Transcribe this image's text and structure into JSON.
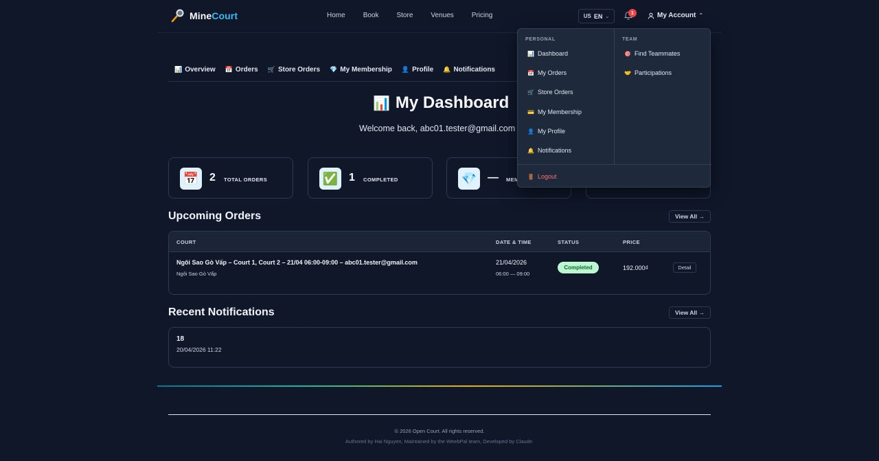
{
  "brand": {
    "name_part1": "Mine",
    "name_part2": "Court"
  },
  "nav": {
    "links": [
      "Home",
      "Book",
      "Store",
      "Venues",
      "Pricing"
    ],
    "lang_country": "US",
    "lang_code": "EN",
    "notification_count": "1",
    "account_label": "My Account"
  },
  "tabs": [
    {
      "icon": "📊",
      "label": "Overview"
    },
    {
      "icon": "📅",
      "label": "Orders"
    },
    {
      "icon": "🛒",
      "label": "Store Orders"
    },
    {
      "icon": "💎",
      "label": "My Membership"
    },
    {
      "icon": "👤",
      "label": "Profile"
    },
    {
      "icon": "🔔",
      "label": "Notifications"
    }
  ],
  "dashboard": {
    "title_icon": "📊",
    "title": "My Dashboard",
    "welcome": "Welcome back, abc01.tester@gmail.com"
  },
  "stats": [
    {
      "icon": "📅",
      "value": "2",
      "label": "TOTAL ORDERS"
    },
    {
      "icon": "✅",
      "value": "1",
      "label": "COMPLETED"
    },
    {
      "icon": "💎",
      "value": "—",
      "label": "MEM"
    }
  ],
  "upcoming": {
    "title": "Upcoming Orders",
    "view_all": "View All →",
    "columns": [
      "COURT",
      "DATE & TIME",
      "STATUS",
      "PRICE"
    ],
    "rows": [
      {
        "court": "Ngôi Sao Gò Vấp – Court 1, Court 2 – 21/04 06:00-09:00 – abc01.tester@gmail.com",
        "venue": "Ngôi Sao Gò Vấp",
        "date": "21/04/2026",
        "time": "06:00 — 09:00",
        "status": "Completed",
        "price": "192.000₫",
        "action": "Detail"
      }
    ]
  },
  "notifications": {
    "title": "Recent Notifications",
    "view_all": "View All →",
    "items": [
      {
        "title": "18",
        "date": "20/04/2026 11:22"
      }
    ]
  },
  "footer": {
    "copyright": "© 2026 Open Court. All rights reserved.",
    "credits": "Authored by Hai Nguyen, Maintained by the WeebPal team, Developed by Claude."
  },
  "account_menu": {
    "personal_header": "PERSONAL",
    "team_header": "TEAM",
    "personal": [
      {
        "icon": "📊",
        "label": "Dashboard"
      },
      {
        "icon": "📅",
        "label": "My Orders"
      },
      {
        "icon": "🛒",
        "label": "Store Orders"
      },
      {
        "icon": "💳",
        "label": "My Membership"
      },
      {
        "icon": "👤",
        "label": "My Profile"
      },
      {
        "icon": "🔔",
        "label": "Notifications"
      }
    ],
    "team": [
      {
        "icon": "🎯",
        "label": "Find Teammates"
      },
      {
        "icon": "🤝",
        "label": "Participations"
      }
    ],
    "logout_icon": "🚪",
    "logout": "Logout"
  },
  "colors": {
    "background": "#0f1729",
    "accent": "#38bdf8",
    "danger": "#ef4444",
    "success_bg": "#bbf7d0"
  }
}
